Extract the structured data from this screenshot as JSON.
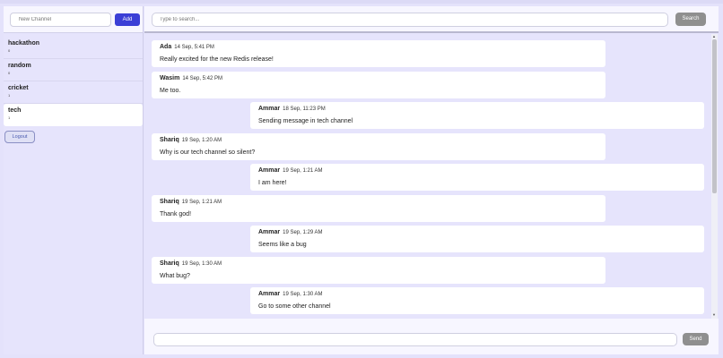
{
  "sidebar": {
    "new_channel_placeholder": "New Channel",
    "add_label": "Add",
    "channels": [
      {
        "name": "hackathon",
        "count": "0"
      },
      {
        "name": "random",
        "count": "0"
      },
      {
        "name": "cricket",
        "count": "1"
      },
      {
        "name": "tech",
        "count": "1"
      }
    ],
    "active_channel": "tech",
    "logout_label": "Logout"
  },
  "search": {
    "placeholder": "Type to search...",
    "button_label": "Search"
  },
  "messages": [
    {
      "author": "Ada",
      "time": "14 Sep, 5:41 PM",
      "text": "Really excited for the new Redis release!",
      "side": "left"
    },
    {
      "author": "Wasim",
      "time": "14 Sep, 5:42 PM",
      "text": "Me too.",
      "side": "left"
    },
    {
      "author": "Ammar",
      "time": "18 Sep, 11:23 PM",
      "text": "Sending message in tech channel",
      "side": "right"
    },
    {
      "author": "Shariq",
      "time": "19 Sep, 1:20 AM",
      "text": "Why is our tech channel so silent?",
      "side": "left"
    },
    {
      "author": "Ammar",
      "time": "19 Sep, 1:21 AM",
      "text": "I am here!",
      "side": "right"
    },
    {
      "author": "Shariq",
      "time": "19 Sep, 1:21 AM",
      "text": "Thank god!",
      "side": "left"
    },
    {
      "author": "Ammar",
      "time": "19 Sep, 1:29 AM",
      "text": "Seems like a bug",
      "side": "right"
    },
    {
      "author": "Shariq",
      "time": "19 Sep, 1:30 AM",
      "text": "What bug?",
      "side": "left"
    },
    {
      "author": "Ammar",
      "time": "19 Sep, 1:30 AM",
      "text": "Go to some other channel",
      "side": "right"
    }
  ],
  "compose": {
    "value": "",
    "send_label": "Send"
  },
  "colors": {
    "background": "#e4e2fb",
    "add_button": "#3b3fd6",
    "gray_button": "#8f8f8f",
    "bubble": "#ffffff"
  }
}
